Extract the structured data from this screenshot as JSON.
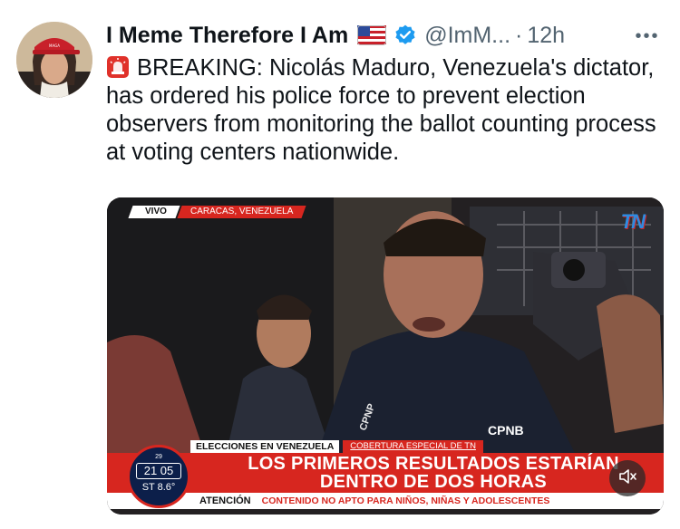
{
  "author": {
    "display_name": "I Meme Therefore I Am",
    "flag_icon": "us-flag-icon",
    "verified_icon": "verified-badge-icon",
    "handle": "@ImM...",
    "separator": "·",
    "time": "12h"
  },
  "more_icon": "more-horizontal-icon",
  "more_label": "•••",
  "tweet": {
    "siren_icon": "police-siren-icon",
    "text": "BREAKING: Nicolás Maduro, Venezuela's dictator, has ordered his police force to prevent election observers from monitoring the ballot counting process at voting centers nationwide."
  },
  "media": {
    "live_tag": "VIVO",
    "location_tag": "CARACAS, VENEZUELA",
    "channel_logo": "TN",
    "vest_label": "CPNB",
    "vest_label_2": "CPNP",
    "topic": "ELECCIONES EN VENEZUELA",
    "special": "COBERTURA ESPECIAL DE TN",
    "headline_line1": "LOS PRIMEROS RESULTADOS ESTARÍAN",
    "headline_line2": "DENTRO DE DOS HORAS",
    "attention_label": "ATENCIÓN",
    "warning_text": "CONTENIDO NO APTO PARA NIÑOS, NIÑAS Y ADOLESCENTES",
    "clock_day": "29",
    "clock_time": "21 05",
    "clock_temp": "ST 8.6°",
    "mute_icon": "volume-muted-icon"
  },
  "colors": {
    "brand_red": "#d7261f",
    "verified_blue": "#1d9bf0",
    "secondary_text": "#536471"
  }
}
